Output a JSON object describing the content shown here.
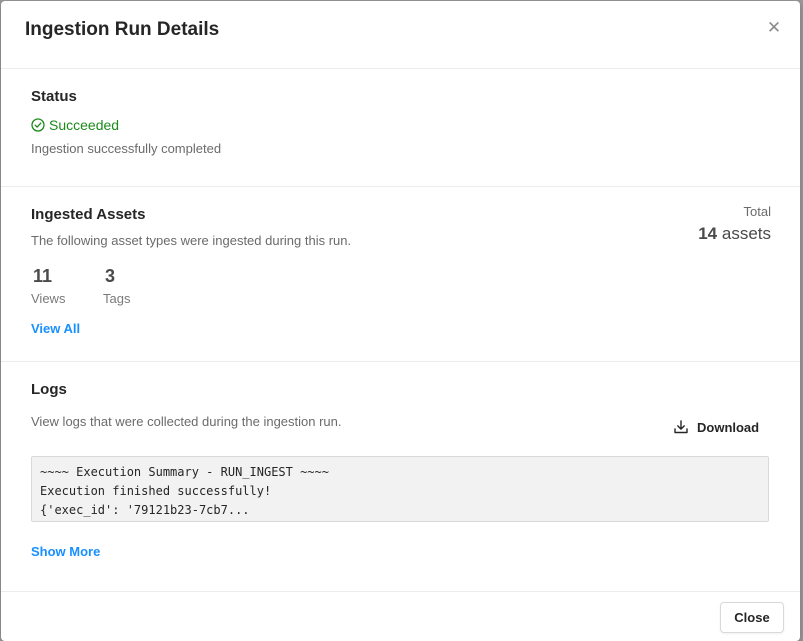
{
  "modal": {
    "title": "Ingestion Run Details",
    "close_icon": "close-icon"
  },
  "status": {
    "heading": "Status",
    "value": "Succeeded",
    "icon": "check-circle-icon",
    "color": "#1b8a1b",
    "description": "Ingestion successfully completed"
  },
  "assets": {
    "heading": "Ingested Assets",
    "description": "The following asset types were ingested during this run.",
    "total_label": "Total",
    "total_count": "14",
    "total_unit": "assets",
    "types": [
      {
        "count": "11",
        "label": "Views"
      },
      {
        "count": "3",
        "label": "Tags"
      }
    ],
    "view_all_label": "View All"
  },
  "logs": {
    "heading": "Logs",
    "description": "View logs that were collected during the ingestion run.",
    "download_label": "Download",
    "download_icon": "download-icon",
    "log_text": "~~~~ Execution Summary - RUN_INGEST ~~~~\nExecution finished successfully!\n{'exec_id': '79121b23-7cb7...",
    "show_more_label": "Show More"
  },
  "footer": {
    "close_label": "Close"
  },
  "colors": {
    "link": "#1890ff",
    "success": "#1b8a1b"
  }
}
